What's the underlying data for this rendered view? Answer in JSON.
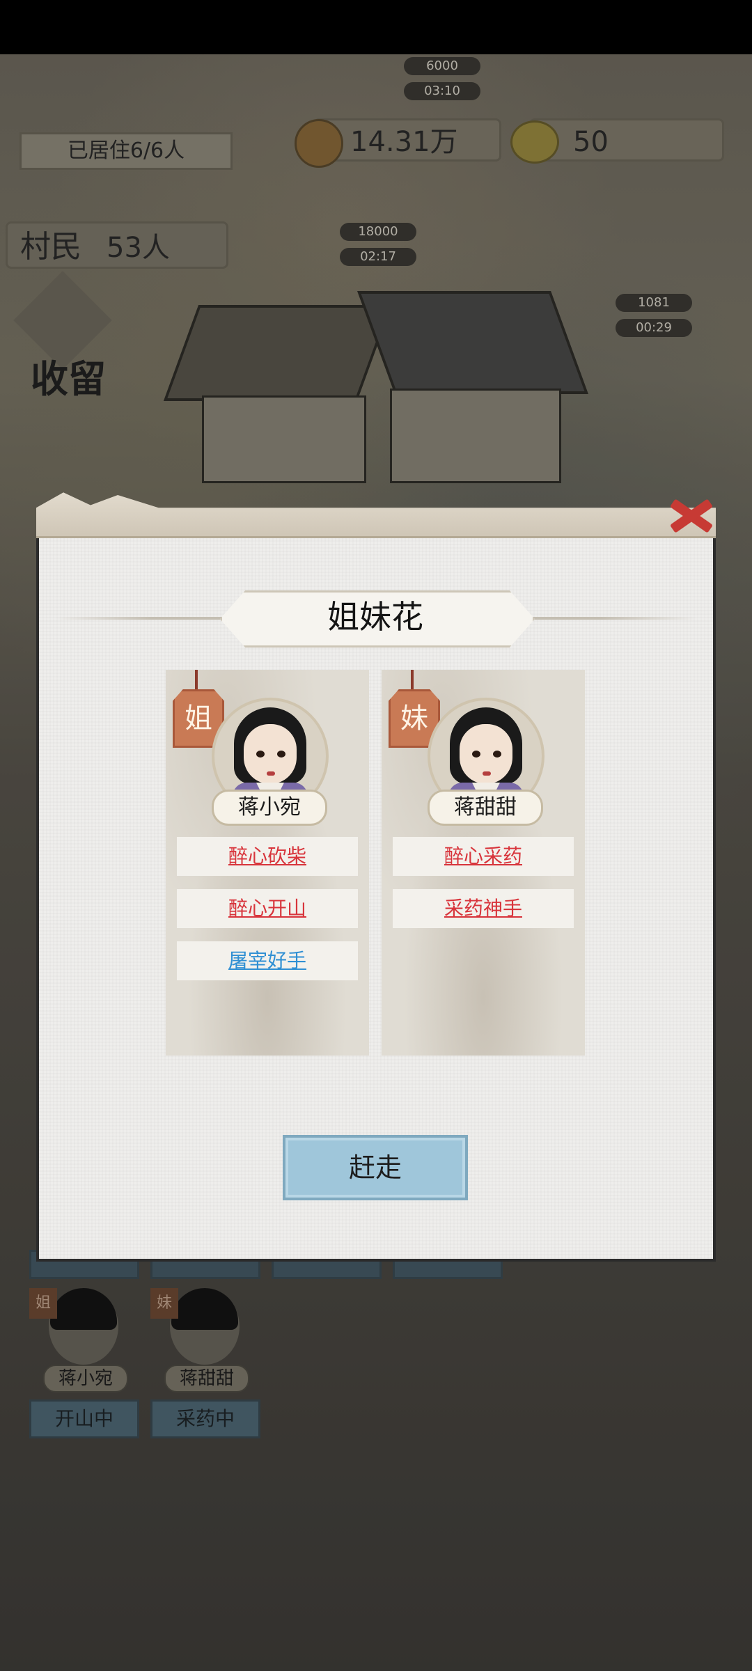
{
  "hud": {
    "resident_label": "已居住6/6人",
    "money_value": "14.31万",
    "fruit_value": "50",
    "villager_label": "村民",
    "villager_count": "53人",
    "timers": [
      {
        "cost": "6000",
        "time": "03:10"
      },
      {
        "cost": "18000",
        "time": "02:17"
      },
      {
        "cost": "1081",
        "time": "00:29"
      }
    ],
    "shoulu_label": "收留"
  },
  "modal": {
    "title": "姐妹花",
    "cards": [
      {
        "tag": "姐",
        "name": "蒋小宛",
        "skills": [
          {
            "label": "醉心砍柴",
            "color": "#d8343b"
          },
          {
            "label": "醉心开山",
            "color": "#d8343b"
          },
          {
            "label": "屠宰好手",
            "color": "#2f8fd3"
          }
        ]
      },
      {
        "tag": "妹",
        "name": "蒋甜甜",
        "skills": [
          {
            "label": "醉心采药",
            "color": "#d8343b"
          },
          {
            "label": "采药神手",
            "color": "#d8343b"
          }
        ]
      }
    ],
    "expel_label": "赶走",
    "close_icon": "close-icon"
  },
  "background_list": [
    {
      "tag": "姐",
      "name": "蒋小宛",
      "status": "开山中"
    },
    {
      "tag": "妹",
      "name": "蒋甜甜",
      "status": "采药中"
    }
  ]
}
